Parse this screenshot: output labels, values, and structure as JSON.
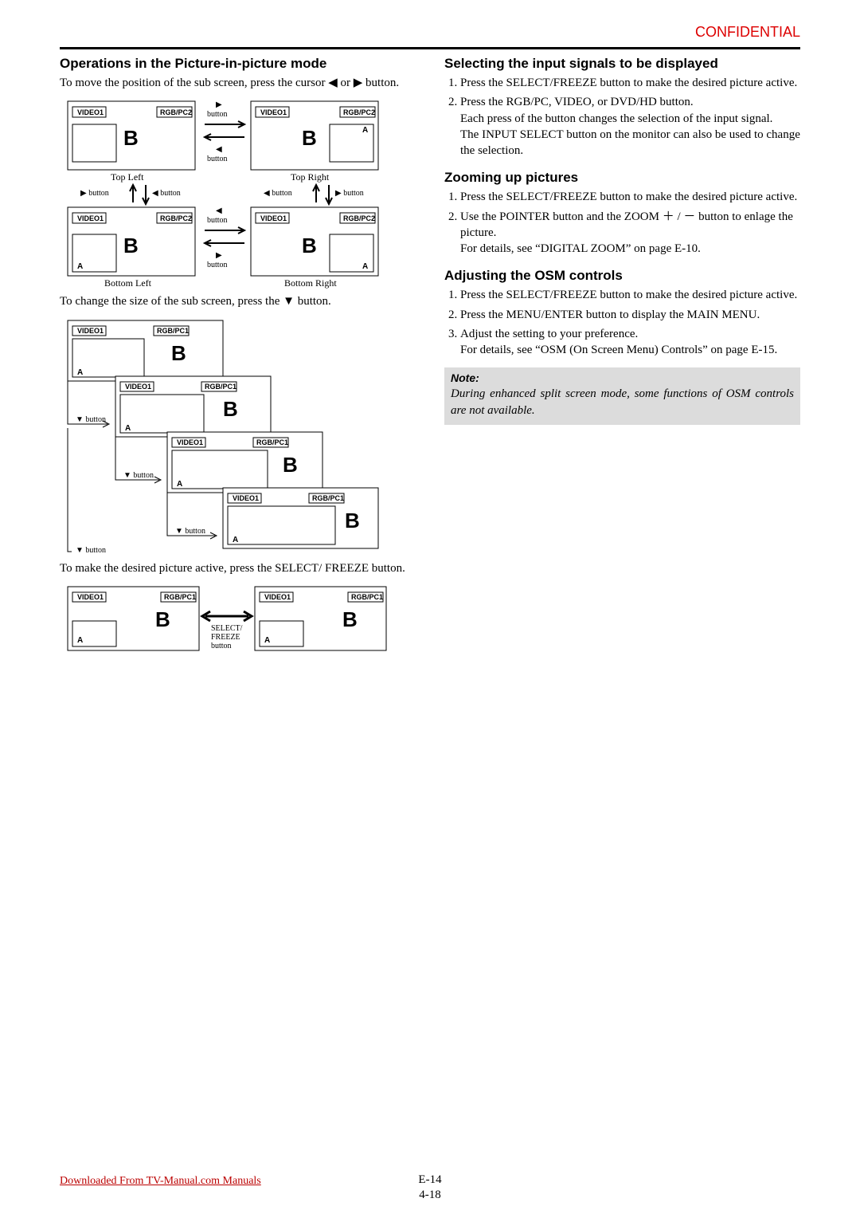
{
  "header": {
    "confidential": "CONFIDENTIAL"
  },
  "left": {
    "h_pip": "Operations in the Picture-in-picture mode",
    "p_move": "To move the position of the sub screen, press the cursor ◀ or ▶ button.",
    "p_size": "To change the size of the sub screen, press the ▼ button.",
    "p_freeze": "To make the desired picture active, press the SELECT/ FREEZE button.",
    "d1": {
      "topLeft": "Top Left",
      "topRight": "Top Right",
      "bottomLeft": "Bottom Left",
      "bottomRight": "Bottom Right",
      "A": "A",
      "B": "B",
      "v1": "VIDEO1",
      "rgb2": "RGB/PC2",
      "btn": "button",
      "rbtn": "▶ button",
      "lbtn": "◀ button"
    },
    "d2": {
      "A": "A",
      "B": "B",
      "v1": "VIDEO1",
      "rgb1": "RGB/PC1",
      "dbtn": "▼ button"
    },
    "d3": {
      "A": "A",
      "B": "B",
      "v1": "VIDEO1",
      "rgb1": "RGB/PC1",
      "sel": "SELECT/\nFREEZE\nbutton"
    }
  },
  "right": {
    "h_input": "Selecting the input signals to be displayed",
    "input_steps": [
      "Press the SELECT/FREEZE button to make the desired picture active.",
      "Press the RGB/PC, VIDEO, or DVD/HD button."
    ],
    "input_cont1": "Each press of the button changes the selection of the input signal.",
    "input_cont2": "The INPUT SELECT button on the monitor can also be used to change the selection.",
    "h_zoom": "Zooming up pictures",
    "zoom_steps": [
      "Press the SELECT/FREEZE button to make the desired picture active.",
      "Use the POINTER button and the ZOOM ＋ / － button to enlage the picture."
    ],
    "zoom_cont": "For details, see “DIGITAL ZOOM” on page E-10.",
    "h_osm": "Adjusting the OSM controls",
    "osm_steps": [
      "Press the SELECT/FREEZE button to make the desired picture active.",
      "Press the MENU/ENTER button to display the MAIN MENU.",
      "Adjust the setting to your preference."
    ],
    "osm_cont": "For details, see “OSM (On Screen Menu) Controls” on page E-15.",
    "note_title": "Note:",
    "note_body": "During enhanced split screen mode, some functions of OSM controls are not available."
  },
  "footer": {
    "download": "Downloaded From TV-Manual.com Manuals",
    "epage": "E-14",
    "docpage": "4-18"
  }
}
